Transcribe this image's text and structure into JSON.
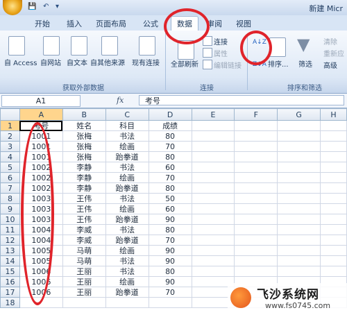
{
  "window": {
    "title": "新建 Micr",
    "quick_access": [
      "💾",
      "↶",
      "▾"
    ]
  },
  "tabs": [
    "开始",
    "插入",
    "页面布局",
    "公式",
    "数据",
    "审阅",
    "视图"
  ],
  "active_tab": "数据",
  "ribbon": {
    "get_external": {
      "label": "获取外部数据",
      "buttons": [
        "自 Access",
        "自网站",
        "自文本",
        "自其他来源",
        "现有连接"
      ]
    },
    "connections": {
      "label": "连接",
      "refresh_all": "全部刷新",
      "items": [
        "连接",
        "属性",
        "编辑链接"
      ]
    },
    "sort_filter": {
      "label": "排序和筛选",
      "sort": "排序...",
      "filter": "筛选",
      "items": [
        "清除",
        "重新应",
        "高级"
      ],
      "az": "A↓Z",
      "za": "Z↓A"
    }
  },
  "formula_bar": {
    "name_box": "A1",
    "fx": "fx",
    "value": "考号"
  },
  "columns": [
    "A",
    "B",
    "C",
    "D",
    "E",
    "F",
    "G",
    "H"
  ],
  "rows": [
    [
      "考号",
      "姓名",
      "科目",
      "成绩"
    ],
    [
      "1001",
      "张梅",
      "书法",
      "80"
    ],
    [
      "1001",
      "张梅",
      "绘画",
      "70"
    ],
    [
      "1001",
      "张梅",
      "跆拳道",
      "80"
    ],
    [
      "1002",
      "李静",
      "书法",
      "60"
    ],
    [
      "1002",
      "李静",
      "绘画",
      "70"
    ],
    [
      "1002",
      "李静",
      "跆拳道",
      "80"
    ],
    [
      "1003",
      "王伟",
      "书法",
      "50"
    ],
    [
      "1003",
      "王伟",
      "绘画",
      "60"
    ],
    [
      "1003",
      "王伟",
      "跆拳道",
      "90"
    ],
    [
      "1004",
      "李威",
      "书法",
      "80"
    ],
    [
      "1004",
      "李威",
      "跆拳道",
      "70"
    ],
    [
      "1005",
      "马萌",
      "绘画",
      "90"
    ],
    [
      "1005",
      "马萌",
      "书法",
      "90"
    ],
    [
      "1006",
      "王丽",
      "书法",
      "80"
    ],
    [
      "1006",
      "王丽",
      "绘画",
      "90"
    ],
    [
      "1006",
      "王丽",
      "跆拳道",
      "70"
    ],
    [
      "",
      "",
      "",
      ""
    ]
  ],
  "watermark": {
    "text": "飞沙系统网",
    "url": "www.fs0745.com"
  },
  "colors": {
    "annotation": "#e0242b",
    "selected_header": "#ffd58d"
  }
}
